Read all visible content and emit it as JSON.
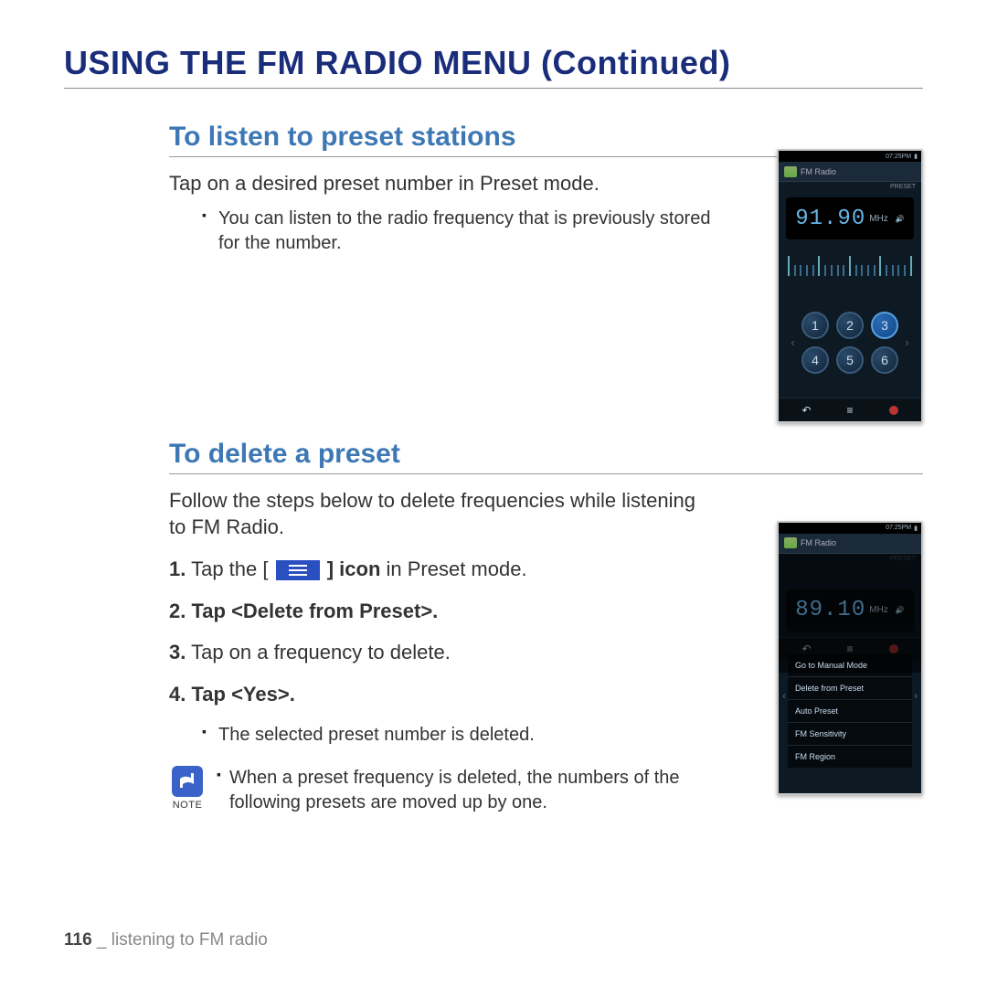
{
  "page_title": "USING THE FM RADIO MENU (Continued)",
  "section1": {
    "heading": "To listen to preset stations",
    "intro": "Tap on a desired preset number in Preset mode.",
    "bullet": "You can listen to the radio frequency that is previously stored for the number."
  },
  "section2": {
    "heading": "To delete a preset",
    "intro": "Follow the steps below to delete frequencies while listening to FM Radio.",
    "step1_num": "1.",
    "step1_pre": "Tap the [",
    "step1_post_bold": "] icon",
    "step1_post": " in Preset mode.",
    "step2_num": "2.",
    "step2": "Tap <Delete from Preset>.",
    "step3_num": "3.",
    "step3": "Tap on a frequency to delete.",
    "step4_num": "4.",
    "step4": "Tap <Yes>.",
    "sub_bullet": "The selected preset number is deleted.",
    "note_label": "NOTE",
    "note_text": "When a preset frequency is deleted, the numbers of the following presets are moved up by one."
  },
  "device1": {
    "status_time": "07:25PM",
    "header_title": "FM Radio",
    "mode_tag": "PRESET",
    "freq": "91.90",
    "freq_unit": "MHz",
    "presets": [
      "1",
      "2",
      "3",
      "4",
      "5",
      "6"
    ],
    "selected": "3"
  },
  "device2": {
    "status_time": "07:25PM",
    "header_title": "FM Radio",
    "mode_tag": "PRESET",
    "freq": "89.10",
    "freq_unit": "MHz",
    "menu_items": [
      "Go to Manual Mode",
      "Delete from Preset",
      "Auto Preset",
      "FM Sensitivity",
      "FM Region"
    ]
  },
  "footer": {
    "page_num": "116",
    "sep": " _ ",
    "chapter": "listening to FM radio"
  }
}
